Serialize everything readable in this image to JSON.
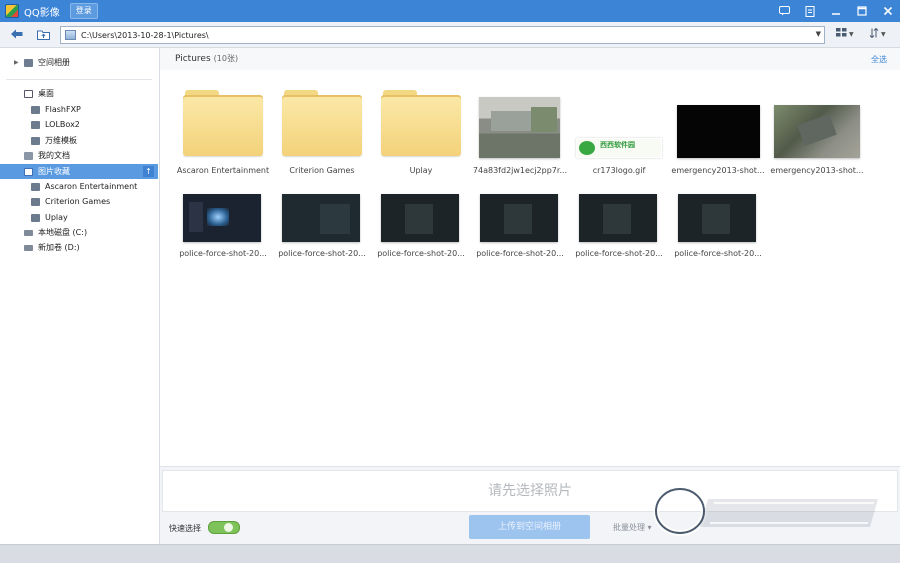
{
  "window": {
    "title": "QQ影像",
    "login_label": "登录"
  },
  "toolbar": {
    "path": "C:\\Users\\2013-10-28-1\\Pictures\\"
  },
  "sidebar": {
    "album": "空间相册",
    "items": [
      {
        "label": "桌面"
      },
      {
        "label": "FlashFXP"
      },
      {
        "label": "LOLBox2"
      },
      {
        "label": "万维模板"
      },
      {
        "label": "我的文档"
      },
      {
        "label": "图片收藏"
      },
      {
        "label": "Ascaron Entertainment"
      },
      {
        "label": "Criterion Games"
      },
      {
        "label": "Uplay"
      },
      {
        "label": "本地磁盘 (C:)"
      },
      {
        "label": "新加卷 (D:)"
      }
    ]
  },
  "content": {
    "title": "Pictures",
    "count": "(10张)",
    "select_all": "全选",
    "items": [
      {
        "caption": "Ascaron Entertainment"
      },
      {
        "caption": "Criterion Games"
      },
      {
        "caption": "Uplay"
      },
      {
        "caption": "74a83fd2jw1ecj2pp7r..."
      },
      {
        "caption": "cr173logo.gif",
        "logo_text": "西西软件园"
      },
      {
        "caption": "emergency2013-shot..."
      },
      {
        "caption": "emergency2013-shot..."
      },
      {
        "caption": "police-force-shot-20..."
      },
      {
        "caption": "police-force-shot-20..."
      },
      {
        "caption": "police-force-shot-20..."
      },
      {
        "caption": "police-force-shot-20..."
      },
      {
        "caption": "police-force-shot-20..."
      },
      {
        "caption": "police-force-shot-20..."
      }
    ]
  },
  "bottom": {
    "hint": "请先选择照片",
    "quick_select": "快速选择",
    "upload": "上传到空间相册",
    "batch": "批量处理"
  },
  "colors": {
    "titlebar": "#3c84d6",
    "selection": "#5a9ae0",
    "accent": "#3c84d6"
  }
}
